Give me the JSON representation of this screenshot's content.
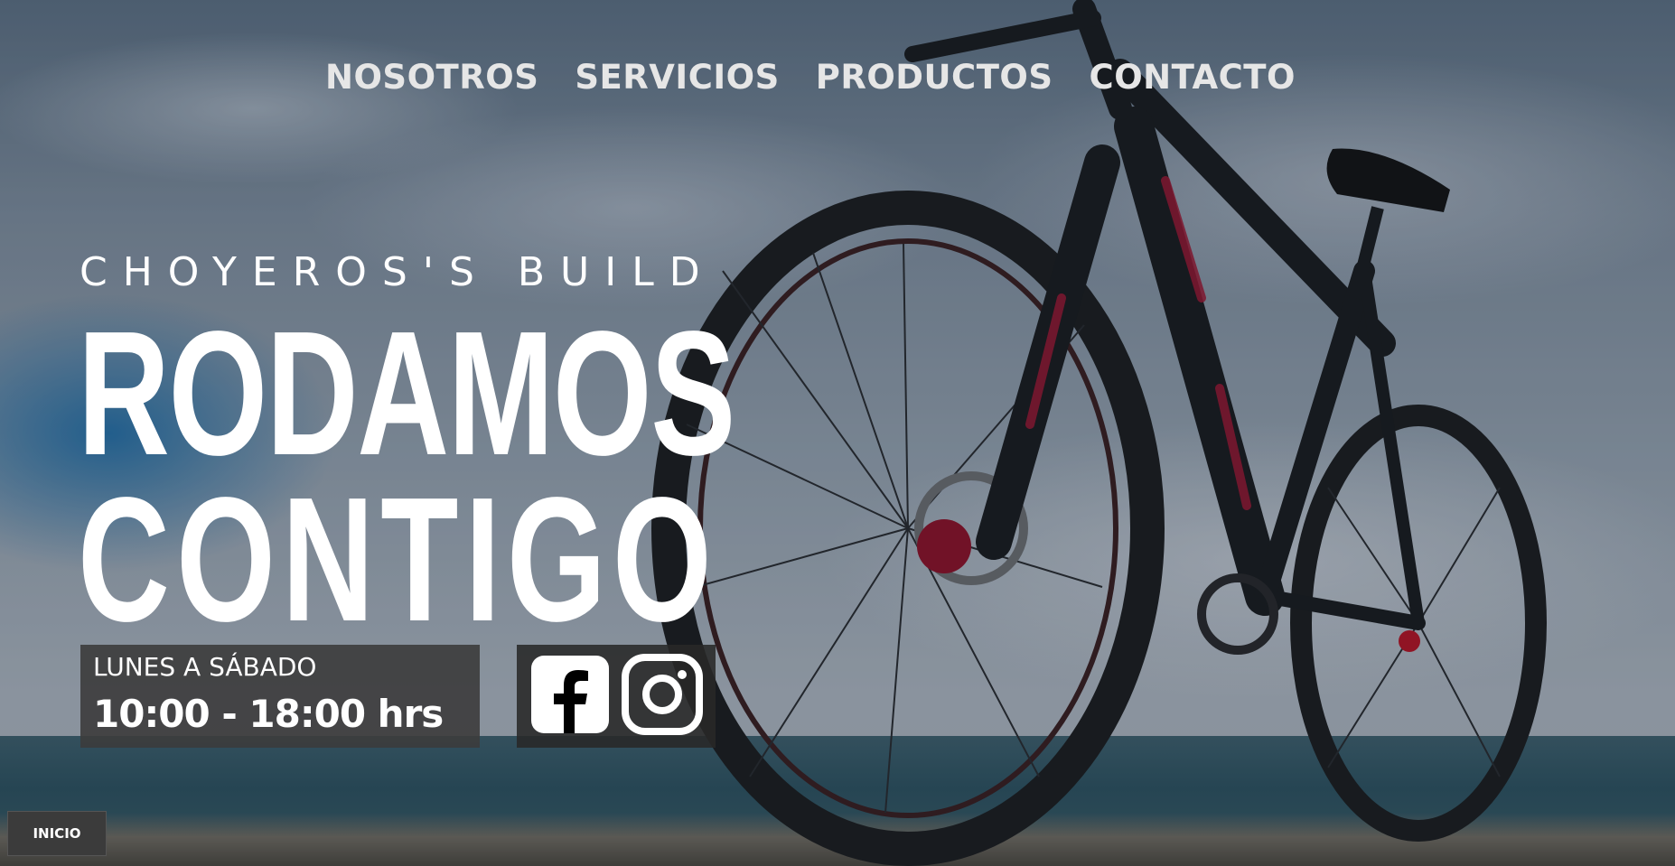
{
  "nav": {
    "items": [
      {
        "label": "NOSOTROS"
      },
      {
        "label": "SERVICIOS"
      },
      {
        "label": "PRODUCTOS"
      },
      {
        "label": "CONTACTO"
      }
    ]
  },
  "hero": {
    "brand": "CHOYEROS'S BUILD",
    "headline_line1": "RODAMOS",
    "headline_line2": "CONTIGO"
  },
  "hours": {
    "days": "LUNES A SÁBADO",
    "time": "10:00 - 18:00 hrs"
  },
  "social": {
    "icons": [
      "facebook-icon",
      "instagram-icon"
    ]
  },
  "footer": {
    "inicio_label": "INICIO"
  },
  "colors": {
    "text": "#ffffff",
    "box_bg": "#3c3c3c",
    "nav_text": "#e6e6e6"
  }
}
